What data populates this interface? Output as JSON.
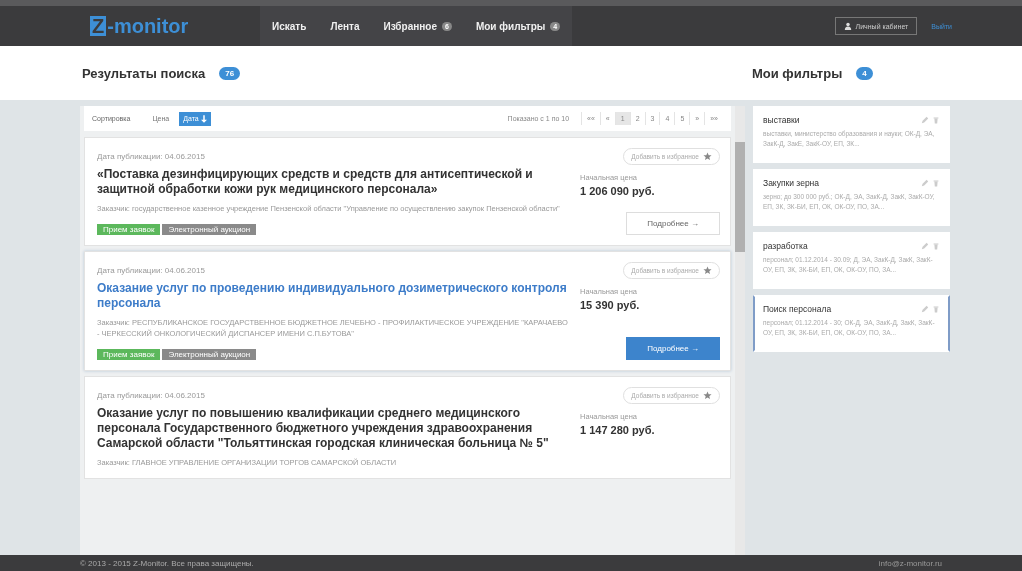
{
  "navbar": {
    "logo": {
      "mark": "Z",
      "text": "-monitor"
    },
    "items": [
      {
        "label": "Искать"
      },
      {
        "label": "Лента"
      },
      {
        "label": "Избранное",
        "badge": "6"
      },
      {
        "label": "Мои фильтры",
        "badge": "4"
      }
    ],
    "account_button": "Личный кабинет",
    "logout_link": "Выйти"
  },
  "results_header": {
    "title": "Результаты поиска",
    "count": "76"
  },
  "filters_header": {
    "title": "Мои фильтры",
    "count": "4"
  },
  "sort_bar": {
    "label": "Сортировка",
    "options": [
      {
        "label": "Цена",
        "selected": false
      },
      {
        "label": "Дата",
        "selected": true
      }
    ],
    "shown": "Показано с 1 по 10",
    "pages": [
      {
        "label": "««",
        "selected": false
      },
      {
        "label": "«",
        "selected": false
      },
      {
        "label": "1",
        "selected": true
      },
      {
        "label": "2",
        "selected": false
      },
      {
        "label": "3",
        "selected": false
      },
      {
        "label": "4",
        "selected": false
      },
      {
        "label": "5",
        "selected": false
      },
      {
        "label": "»",
        "selected": false
      },
      {
        "label": "»»",
        "selected": false
      }
    ]
  },
  "results": [
    {
      "date": "Дата публикации: 04.06.2015",
      "favorite": "Добавить в избранное",
      "title": "«Поставка дезинфицирующих средств и средств для антисептической и защитной обработки кожи рук медицинского персонала»",
      "price_label": "Начальная цена",
      "price": "1 206 090 руб.",
      "customer": "Заказчик: государственное казенное учреждение Пензенской области \"Управление по осуществлению закупок Пензенской области\"",
      "tags": [
        {
          "label": "Прием заявок",
          "color": "#5cb85c"
        },
        {
          "label": "Электронный аукцион",
          "color": "#8a8a8a"
        }
      ],
      "details": "Подробнее →",
      "selected": false
    },
    {
      "date": "Дата публикации: 04.06.2015",
      "favorite": "Добавить в избранное",
      "title": "Оказание услуг по проведению индивидуального дозиметрического контроля персонала",
      "price_label": "Начальная цена",
      "price": "15 390 руб.",
      "customer": "Заказчик: РЕСПУБЛИКАНСКОЕ ГОСУДАРСТВЕННОЕ БЮДЖЕТНОЕ ЛЕЧЕБНО - ПРОФИЛАКТИЧЕСКОЕ УЧРЕЖДЕНИЕ \"КАРАЧАЕВО - ЧЕРКЕССКИЙ ОНКОЛОГИЧЕСКИЙ ДИСПАНСЕР ИМЕНИ С.П.БУТОВА\"",
      "tags": [
        {
          "label": "Прием заявок",
          "color": "#5cb85c"
        },
        {
          "label": "Электронный аукцион",
          "color": "#8a8a8a"
        }
      ],
      "details": "Подробнее →",
      "selected": true
    },
    {
      "date": "Дата публикации: 04.06.2015",
      "favorite": "Добавить в избранное",
      "title": "Оказание услуг по повышению квалификации среднего медицинского персонала Государственного бюджетного учреждения здравоохранения Самарской области \"Тольяттинская городская клиническая больница № 5\"",
      "price_label": "Начальная цена",
      "price": "1 147 280 руб.",
      "customer": "Заказчик: ГЛАВНОЕ УПРАВЛЕНИЕ ОРГАНИЗАЦИИ ТОРГОВ САМАРСКОЙ ОБЛАСТИ",
      "selected": false
    }
  ],
  "filters": [
    {
      "name": "выставки",
      "summary": "выставки, министерство образования и науки; ОК-Д, ЭА, ЗакК-Д, ЗакЕ, ЗакК-ОУ, ЕП, ЗК...",
      "selected": false
    },
    {
      "name": "Закупки зерна",
      "summary": "зерно; до 300 000 руб.; ОК-Д, ЭА, ЗакК-Д, ЗакК, ЗакК-ОУ, ЕП, ЗК, ЗК-БИ, ЕП, ОК, ОК-ОУ, ПО, ЗА...",
      "selected": false
    },
    {
      "name": "разработка",
      "summary": "персонал; 01.12.2014 - 30.09; Д, ЭА, ЗакК-Д, ЗакК, ЗакК-ОУ, ЕП, ЗК, ЗК-БИ, ЕП, ОК, ОК-ОУ, ПО, ЗА...",
      "selected": false
    },
    {
      "name": "Поиск персонала",
      "summary": "персонал; 01.12.2014 - 30; ОК-Д, ЭА, ЗакК-Д, ЗакК, ЗакК-ОУ, ЕП, ЗК, ЗК-БИ, ЕП, ОК, ОК-ОУ, ПО, ЗА...",
      "selected": true
    }
  ],
  "footer": {
    "copyright": "© 2013 - 2015 Z-Monitor. Все права защищены.",
    "email": "info@z-monitor.ru"
  }
}
